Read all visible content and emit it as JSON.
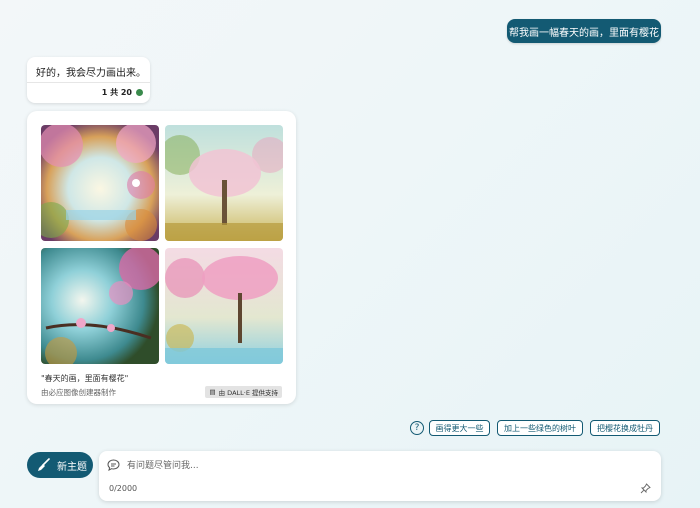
{
  "user_message": "帮我画一幅春天的画，里面有樱花",
  "bot_reply": {
    "text": "好的，我会尽力画出来。",
    "counter": "1 共 20"
  },
  "image_card": {
    "caption": "\"春天的画，里面有樱花\"",
    "creator": "由必应图像创建器制作",
    "powered_by": "由 DALL·E 提供支持",
    "images": [
      "cherry-blossom-arch",
      "blossom-tree-soft",
      "blossom-branch-lake",
      "blossom-tree-pink"
    ]
  },
  "suggestions": [
    "画得更大一些",
    "加上一些绿色的树叶",
    "把樱花换成牡丹"
  ],
  "new_topic_label": "新主题",
  "input": {
    "placeholder": "有问题尽管问我...",
    "value": "",
    "char_count": "0/2000"
  },
  "colors": {
    "accent": "#135a73",
    "status_green": "#3a8a4c"
  }
}
